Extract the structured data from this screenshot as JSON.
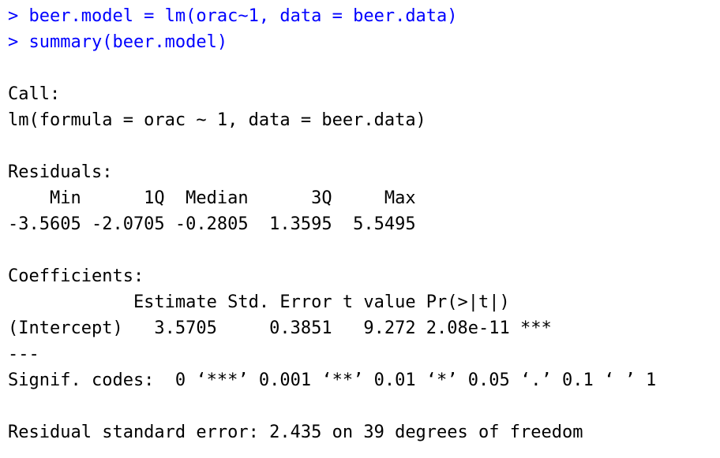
{
  "console": {
    "commands": [
      "> beer.model = lm(orac~1, data = beer.data)",
      "> summary(beer.model)"
    ],
    "output": [
      "",
      "Call:",
      "lm(formula = orac ~ 1, data = beer.data)",
      "",
      "Residuals:",
      "    Min      1Q  Median      3Q     Max ",
      "-3.5605 -2.0705 -0.2805  1.3595  5.5495 ",
      "",
      "Coefficients:",
      "            Estimate Std. Error t value Pr(>|t|)    ",
      "(Intercept)   3.5705     0.3851   9.272 2.08e-11 ***",
      "---",
      "Signif. codes:  0 ‘***’ 0.001 ‘**’ 0.01 ‘*’ 0.05 ‘.’ 0.1 ‘ ’ 1",
      "",
      "Residual standard error: 2.435 on 39 degrees of freedom"
    ]
  },
  "colors": {
    "command": "#0000ff",
    "output": "#000000",
    "background": "#ffffff"
  }
}
